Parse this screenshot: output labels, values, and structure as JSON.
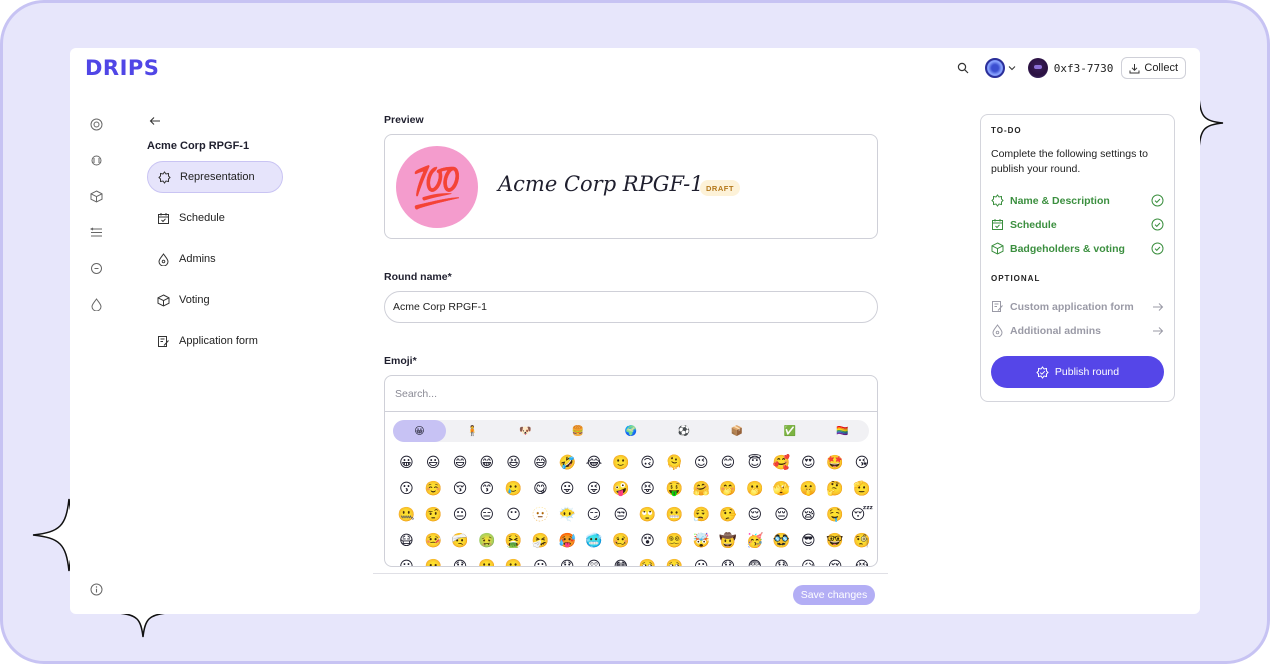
{
  "app": {
    "logo": "DRIPS"
  },
  "header": {
    "wallet_address": "0xf3-7730",
    "collect_label": "Collect"
  },
  "rail": {
    "icons": [
      "explore-icon",
      "streams-icon",
      "projects-icon",
      "funds-icon",
      "drip-lists-icon",
      "rounds-icon"
    ],
    "bottom_icon": "info-icon"
  },
  "nav": {
    "round_title": "Acme Corp RPGF-1",
    "items": [
      {
        "label": "Representation",
        "icon": "badge-icon",
        "active": true
      },
      {
        "label": "Schedule",
        "icon": "calendar-icon",
        "active": false
      },
      {
        "label": "Admins",
        "icon": "drop-icon",
        "active": false
      },
      {
        "label": "Voting",
        "icon": "box-icon",
        "active": false
      },
      {
        "label": "Application form",
        "icon": "form-icon",
        "active": false
      }
    ]
  },
  "preview": {
    "label": "Preview",
    "emoji": "💯",
    "name": "Acme Corp RPGF-1",
    "badge": "DRAFT",
    "circle_color": "#f49ccd"
  },
  "round_name": {
    "label": "Round name*",
    "value": "Acme Corp RPGF-1"
  },
  "emoji_picker": {
    "label": "Emoji*",
    "search_placeholder": "Search...",
    "categories": [
      "😀",
      "🧍",
      "🐶",
      "🍔",
      "🌍",
      "⚽",
      "📦",
      "✅",
      "🏳️‍🌈"
    ],
    "emojis": [
      "😀",
      "😃",
      "😄",
      "😁",
      "😆",
      "😅",
      "🤣",
      "😂",
      "🙂",
      "🙃",
      "🫠",
      "😉",
      "😊",
      "😇",
      "🥰",
      "😍",
      "🤩",
      "😘",
      "😗",
      "☺️",
      "😚",
      "😙",
      "🥲",
      "😋",
      "😛",
      "😜",
      "🤪",
      "😝",
      "🤑",
      "🤗",
      "🤭",
      "🫢",
      "🫣",
      "🤫",
      "🤔",
      "🫡",
      "🤐",
      "🤨",
      "😐",
      "😑",
      "😶",
      "🫥",
      "😶‍🌫️",
      "😏",
      "😒",
      "🙄",
      "😬",
      "😮‍💨",
      "🤥",
      "😌",
      "😔",
      "😪",
      "🤤",
      "😴",
      "😷",
      "🤒",
      "🤕",
      "🤢",
      "🤮",
      "🤧",
      "🥵",
      "🥶",
      "🥴",
      "😵",
      "😵‍💫",
      "🤯",
      "🤠",
      "🥳",
      "🥸",
      "😎",
      "🤓",
      "🧐",
      "😕",
      "🫤",
      "😟",
      "🙁",
      "☹️",
      "😮",
      "😯",
      "😲",
      "😳",
      "🥺",
      "🥹",
      "😦",
      "😧",
      "😨",
      "😰",
      "😥",
      "😢",
      "😭"
    ]
  },
  "actions": {
    "save_label": "Save changes"
  },
  "todo": {
    "heading": "TO-DO",
    "description": "Complete the following settings to publish your round.",
    "required": [
      {
        "label": "Name & Description",
        "icon": "badge-icon"
      },
      {
        "label": "Schedule",
        "icon": "calendar-icon"
      },
      {
        "label": "Badgeholders & voting",
        "icon": "box-icon"
      }
    ],
    "optional_heading": "OPTIONAL",
    "optional": [
      {
        "label": "Custom application form",
        "icon": "form-icon"
      },
      {
        "label": "Additional admins",
        "icon": "drop-icon"
      }
    ],
    "publish_label": "Publish round",
    "done_color": "#3b8f3f",
    "accent_color": "#5546e8"
  }
}
